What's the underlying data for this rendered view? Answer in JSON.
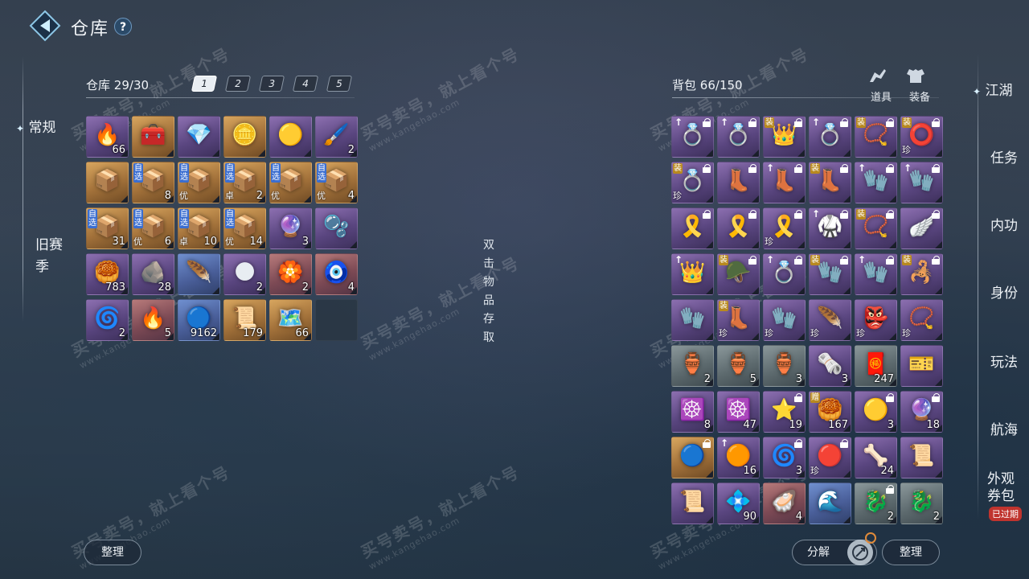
{
  "header": {
    "title": "仓库",
    "help": "?"
  },
  "left_nav": {
    "items": [
      "常规",
      "旧赛季"
    ]
  },
  "warehouse": {
    "label": "仓库",
    "count": "29/30",
    "tabs": [
      "1",
      "2",
      "3",
      "4",
      "5"
    ],
    "slots": [
      {
        "rarity": "purple",
        "icon": "🔥",
        "qty": "66"
      },
      {
        "rarity": "gold",
        "icon": "🧰",
        "qty": ""
      },
      {
        "rarity": "purple",
        "icon": "💎",
        "qty": ""
      },
      {
        "rarity": "gold",
        "icon": "🪙",
        "qty": ""
      },
      {
        "rarity": "purple",
        "icon": "🟡",
        "qty": ""
      },
      {
        "rarity": "purple",
        "icon": "🖌️",
        "qty": "2"
      },
      {
        "rarity": "gold",
        "icon": "📦",
        "qty": ""
      },
      {
        "rarity": "gold",
        "icon": "📦",
        "qty": "8",
        "tag": "自选"
      },
      {
        "rarity": "gold",
        "icon": "📦",
        "qty": "",
        "tag": "自选",
        "grade": "优"
      },
      {
        "rarity": "gold",
        "icon": "📦",
        "qty": "2",
        "tag": "自选",
        "grade": "卓"
      },
      {
        "rarity": "gold",
        "icon": "📦",
        "qty": "",
        "tag": "自选",
        "grade": "优"
      },
      {
        "rarity": "gold",
        "icon": "📦",
        "qty": "4",
        "tag": "自选",
        "grade": "优"
      },
      {
        "rarity": "gold",
        "icon": "📦",
        "qty": "31",
        "tag": "自选"
      },
      {
        "rarity": "gold",
        "icon": "📦",
        "qty": "6",
        "tag": "自选",
        "grade": "优"
      },
      {
        "rarity": "gold",
        "icon": "📦",
        "qty": "10",
        "tag": "自选",
        "grade": "卓"
      },
      {
        "rarity": "gold",
        "icon": "📦",
        "qty": "14",
        "tag": "自选",
        "grade": "优"
      },
      {
        "rarity": "purple",
        "icon": "🔮",
        "qty": "3"
      },
      {
        "rarity": "purple",
        "icon": "🫧",
        "qty": ""
      },
      {
        "rarity": "purple",
        "icon": "🥮",
        "qty": "783"
      },
      {
        "rarity": "purple",
        "icon": "🪨",
        "qty": "28"
      },
      {
        "rarity": "blue",
        "icon": "🪶",
        "qty": ""
      },
      {
        "rarity": "purple",
        "icon": "🌑",
        "qty": "2"
      },
      {
        "rarity": "red",
        "icon": "🏵️",
        "qty": "2"
      },
      {
        "rarity": "red",
        "icon": "🧿",
        "qty": "4"
      },
      {
        "rarity": "purple",
        "icon": "🌀",
        "qty": "2"
      },
      {
        "rarity": "red",
        "icon": "🔥",
        "qty": "5"
      },
      {
        "rarity": "blue",
        "icon": "🔵",
        "qty": "9162"
      },
      {
        "rarity": "gold",
        "icon": "📜",
        "qty": "179"
      },
      {
        "rarity": "gold",
        "icon": "🗺️",
        "qty": "66"
      },
      {
        "rarity": "empty",
        "icon": "",
        "qty": ""
      }
    ],
    "sort_button": "整理"
  },
  "middle": {
    "hint": [
      "双",
      "击",
      "物",
      "品",
      "存",
      "取"
    ]
  },
  "bag": {
    "label": "背包",
    "count": "66/150",
    "tabs": [
      {
        "label": "道具",
        "icon": "bag-icon"
      },
      {
        "label": "装备",
        "icon": "armor-icon"
      }
    ],
    "slots": [
      {
        "rarity": "purple",
        "icon": "💍",
        "lock": true,
        "up": true
      },
      {
        "rarity": "purple",
        "icon": "💍",
        "lock": true,
        "up": true
      },
      {
        "rarity": "purple",
        "icon": "👑",
        "lock": true,
        "tag": "装"
      },
      {
        "rarity": "purple",
        "icon": "💍",
        "lock": true,
        "up": true
      },
      {
        "rarity": "purple",
        "icon": "📿",
        "lock": true,
        "tag": "装"
      },
      {
        "rarity": "purple",
        "icon": "⭕",
        "lock": true,
        "tag": "装",
        "grade": "珍"
      },
      {
        "rarity": "purple",
        "icon": "💍",
        "lock": true,
        "tag": "装",
        "grade": "珍"
      },
      {
        "rarity": "purple",
        "icon": "👢",
        "lock": true
      },
      {
        "rarity": "purple",
        "icon": "👢",
        "lock": true,
        "up": true
      },
      {
        "rarity": "purple",
        "icon": "👢",
        "lock": true,
        "tag": "装"
      },
      {
        "rarity": "purple",
        "icon": "🧤",
        "lock": true,
        "up": true
      },
      {
        "rarity": "purple",
        "icon": "🧤",
        "lock": true,
        "up": true
      },
      {
        "rarity": "purple",
        "icon": "🎗️",
        "lock": true
      },
      {
        "rarity": "purple",
        "icon": "🎗️",
        "lock": true
      },
      {
        "rarity": "purple",
        "icon": "🎗️",
        "lock": true,
        "grade": "珍"
      },
      {
        "rarity": "purple",
        "icon": "🥋",
        "lock": true,
        "up": true
      },
      {
        "rarity": "purple",
        "icon": "📿",
        "lock": true,
        "tag": "装"
      },
      {
        "rarity": "purple",
        "icon": "🪽",
        "lock": true
      },
      {
        "rarity": "purple",
        "icon": "👑",
        "lock": false,
        "up": true
      },
      {
        "rarity": "purple",
        "icon": "🪖",
        "lock": true,
        "tag": "装"
      },
      {
        "rarity": "purple",
        "icon": "💍",
        "lock": true,
        "up": true
      },
      {
        "rarity": "purple",
        "icon": "🧤",
        "lock": true,
        "tag": "装"
      },
      {
        "rarity": "purple",
        "icon": "🧤",
        "lock": true,
        "up": true
      },
      {
        "rarity": "purple",
        "icon": "🦂",
        "lock": true,
        "tag": "装"
      },
      {
        "rarity": "purple",
        "icon": "🧤",
        "lock": false
      },
      {
        "rarity": "purple",
        "icon": "👢",
        "lock": false,
        "tag": "装",
        "grade": "珍"
      },
      {
        "rarity": "purple",
        "icon": "🧤",
        "lock": false,
        "grade": "珍"
      },
      {
        "rarity": "purple",
        "icon": "🪶",
        "lock": false,
        "grade": "珍"
      },
      {
        "rarity": "purple",
        "icon": "👺",
        "lock": false,
        "grade": "珍"
      },
      {
        "rarity": "purple",
        "icon": "📿",
        "lock": false,
        "grade": "珍"
      },
      {
        "rarity": "green",
        "icon": "🏺",
        "qty": "2"
      },
      {
        "rarity": "green",
        "icon": "🏺",
        "qty": "5"
      },
      {
        "rarity": "green",
        "icon": "🏺",
        "qty": "3"
      },
      {
        "rarity": "purple",
        "icon": "🗞️",
        "qty": "3"
      },
      {
        "rarity": "green",
        "icon": "🧧",
        "qty": "247"
      },
      {
        "rarity": "purple",
        "icon": "🎫",
        "qty": ""
      },
      {
        "rarity": "purple",
        "icon": "☸️",
        "qty": "8"
      },
      {
        "rarity": "purple",
        "icon": "☸️",
        "qty": "47"
      },
      {
        "rarity": "purple",
        "icon": "⭐",
        "qty": "19",
        "lock": true
      },
      {
        "rarity": "purple",
        "icon": "🥮",
        "qty": "167",
        "tag": "赠"
      },
      {
        "rarity": "purple",
        "icon": "🟡",
        "qty": "3",
        "lock": true
      },
      {
        "rarity": "purple",
        "icon": "🔮",
        "qty": "18",
        "lock": true
      },
      {
        "rarity": "gold",
        "icon": "🔵",
        "qty": "",
        "lock": true
      },
      {
        "rarity": "purple",
        "icon": "🟠",
        "qty": "16",
        "up": true
      },
      {
        "rarity": "purple",
        "icon": "🌀",
        "qty": "3",
        "lock": true
      },
      {
        "rarity": "purple",
        "icon": "🔴",
        "qty": "",
        "lock": true,
        "grade": "珍"
      },
      {
        "rarity": "purple",
        "icon": "🦴",
        "qty": "24"
      },
      {
        "rarity": "purple",
        "icon": "📜",
        "qty": ""
      },
      {
        "rarity": "purple",
        "icon": "📜",
        "qty": ""
      },
      {
        "rarity": "purple",
        "icon": "💠",
        "qty": "90"
      },
      {
        "rarity": "red",
        "icon": "🦪",
        "qty": "4"
      },
      {
        "rarity": "blue",
        "icon": "🌊",
        "qty": ""
      },
      {
        "rarity": "green",
        "icon": "🐉",
        "qty": "2",
        "lock": true
      },
      {
        "rarity": "green",
        "icon": "🐉",
        "qty": "2"
      }
    ],
    "decompose_button": "分解",
    "sort_button": "整理"
  },
  "right_nav": {
    "items": [
      "江湖",
      "任务",
      "内功",
      "身份",
      "玩法",
      "航海",
      "外观券包"
    ],
    "expired_badge": "已过期"
  },
  "watermark": {
    "text": "买号卖号，就上看个号",
    "url": "www.kangehao.com",
    "brand": "看个号"
  }
}
